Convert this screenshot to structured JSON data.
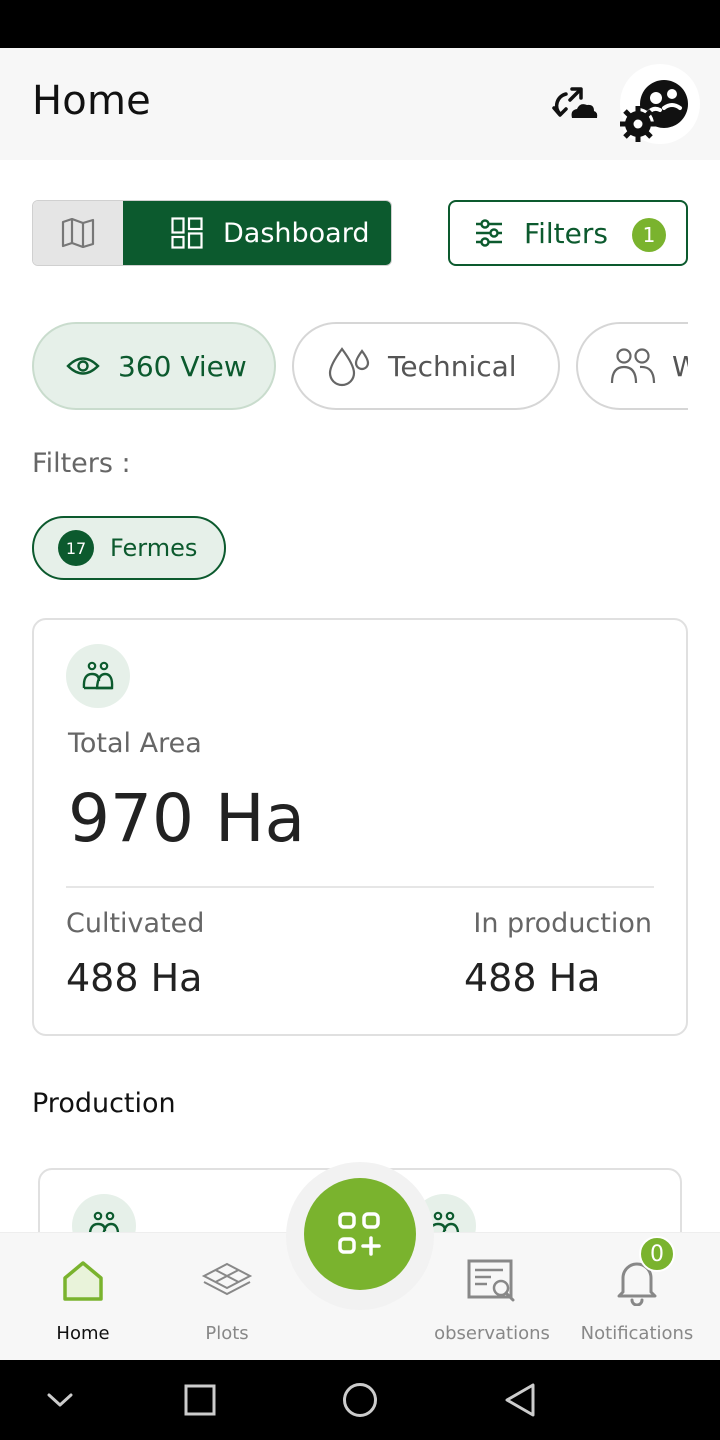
{
  "header": {
    "title": "Home"
  },
  "view_toggle": {
    "dashboard_label": "Dashboard"
  },
  "filters_button": {
    "label": "Filters",
    "count": "1"
  },
  "chips": [
    {
      "label": "360 View"
    },
    {
      "label": "Technical"
    },
    {
      "label": "W"
    }
  ],
  "filters_section": {
    "label": "Filters :",
    "active": [
      {
        "count": "17",
        "label": "Fermes"
      }
    ]
  },
  "area_card": {
    "total_label": "Total Area",
    "total_value": "970 Ha",
    "cultivated_label": "Cultivated",
    "cultivated_value": "488 Ha",
    "production_label": "In production",
    "production_value": "488 Ha"
  },
  "production_section": {
    "title": "Production"
  },
  "bottom_nav": {
    "home": "Home",
    "plots": "Plots",
    "observations": "observations",
    "notifications": "Notifications",
    "notification_count": "0"
  },
  "colors": {
    "primary": "#0c5a2e",
    "accent": "#7ab32e",
    "chip_bg": "#e6f0e9"
  }
}
